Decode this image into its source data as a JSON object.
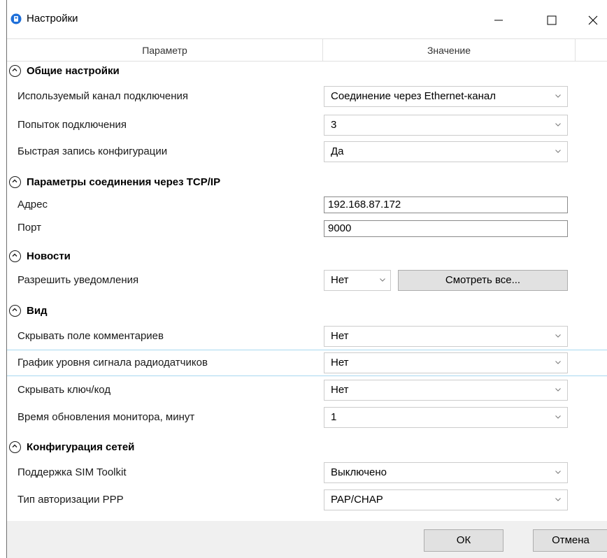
{
  "window": {
    "title": "Настройки"
  },
  "header": {
    "param": "Параметр",
    "value": "Значение"
  },
  "sections": {
    "general": {
      "title": "Общие настройки",
      "channel": {
        "label": "Используемый канал подключения",
        "value": "Соединение через Ethernet-канал"
      },
      "attempts": {
        "label": "Попыток подключения",
        "value": "3"
      },
      "fastwrite": {
        "label": "Быстрая запись конфигурации",
        "value": "Да"
      }
    },
    "tcp": {
      "title": "Параметры соединения через TCP/IP",
      "address": {
        "label": "Адрес",
        "value": "192.168.87.172"
      },
      "port": {
        "label": "Порт",
        "value": "9000"
      }
    },
    "news": {
      "title": "Новости",
      "notify": {
        "label": "Разрешить уведомления",
        "value": "Нет",
        "button": "Смотреть все..."
      }
    },
    "view": {
      "title": "Вид",
      "hide_comments": {
        "label": "Скрывать поле комментариев",
        "value": "Нет"
      },
      "signal_graph": {
        "label": "График уровня сигнала радиодатчиков",
        "value": "Нет"
      },
      "hide_key": {
        "label": "Скрывать ключ/код",
        "value": "Нет"
      },
      "monitor_refresh": {
        "label": "Время обновления монитора, минут",
        "value": "1"
      }
    },
    "network": {
      "title": "Конфигурация сетей",
      "sim_toolkit": {
        "label": "Поддержка SIM Toolkit",
        "value": "Выключено"
      },
      "ppp_auth": {
        "label": "Тип авторизации PPP",
        "value": "PAP/CHAP"
      }
    }
  },
  "footer": {
    "ok": "ОК",
    "cancel": "Отмена"
  },
  "icons": {
    "app": "settings-app-icon",
    "collapse": "chevron-up-circle-icon",
    "dropdown": "chevron-down-icon"
  },
  "colors": {
    "app_icon": "#1e6fd9",
    "selection_border": "#a8d8f0",
    "footer_bg": "#f0f0f0"
  }
}
